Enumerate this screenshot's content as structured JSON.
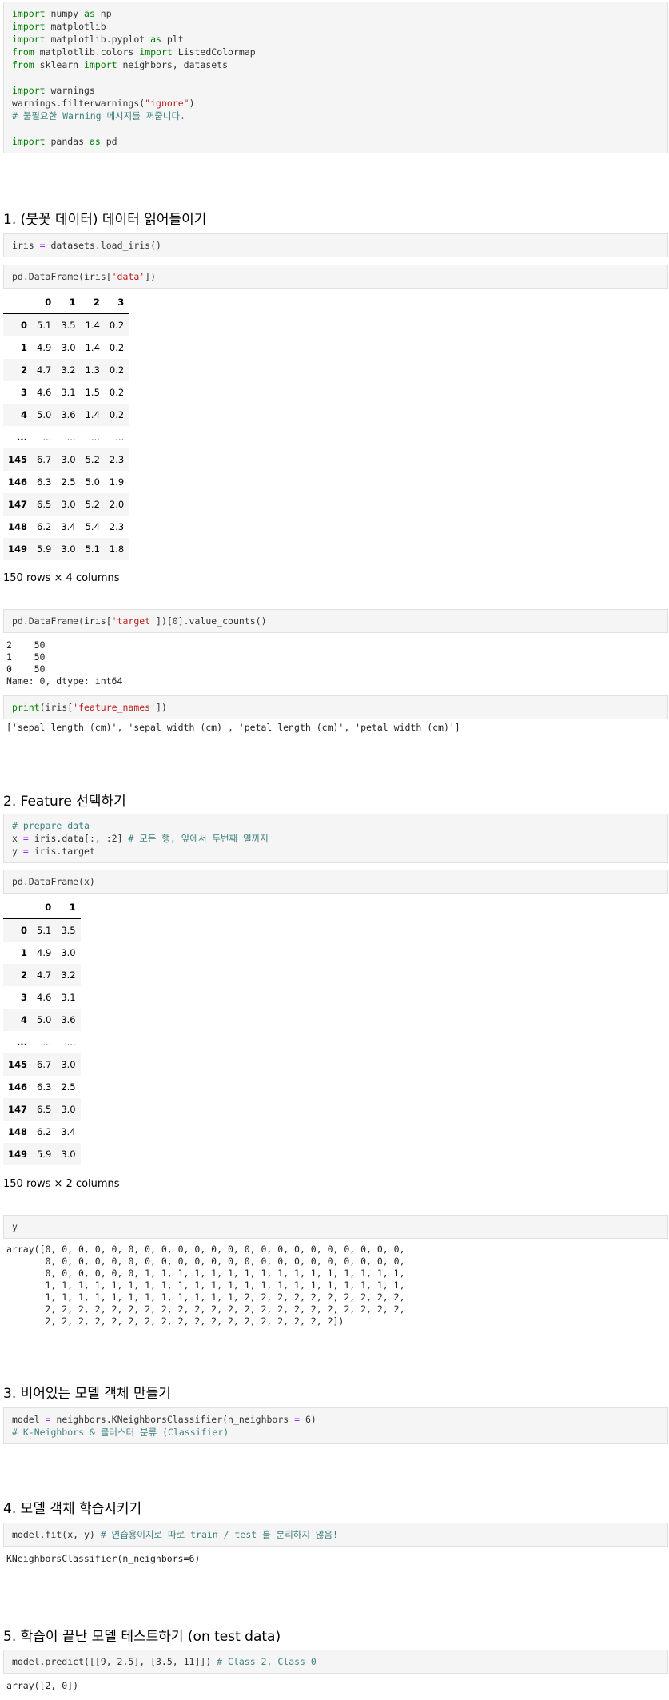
{
  "cells": {
    "imports": [
      {
        "parts": [
          {
            "t": "import",
            "c": "kw"
          },
          {
            "t": " numpy "
          },
          {
            "t": "as",
            "c": "kw"
          },
          {
            "t": " np"
          }
        ]
      },
      {
        "parts": [
          {
            "t": "import",
            "c": "kw"
          },
          {
            "t": " matplotlib"
          }
        ]
      },
      {
        "parts": [
          {
            "t": "import",
            "c": "kw"
          },
          {
            "t": " matplotlib.pyplot "
          },
          {
            "t": "as",
            "c": "kw"
          },
          {
            "t": " plt"
          }
        ]
      },
      {
        "parts": [
          {
            "t": "from",
            "c": "kw"
          },
          {
            "t": " matplotlib.colors "
          },
          {
            "t": "import",
            "c": "kw"
          },
          {
            "t": " ListedColormap"
          }
        ]
      },
      {
        "parts": [
          {
            "t": "from",
            "c": "kw"
          },
          {
            "t": " sklearn "
          },
          {
            "t": "import",
            "c": "kw"
          },
          {
            "t": " neighbors, datasets"
          }
        ]
      },
      {
        "parts": [
          {
            "t": ""
          }
        ]
      },
      {
        "parts": [
          {
            "t": "import",
            "c": "kw"
          },
          {
            "t": " warnings"
          }
        ]
      },
      {
        "parts": [
          {
            "t": "warnings.filterwarnings("
          },
          {
            "t": "\"ignore\"",
            "c": "str"
          },
          {
            "t": ")"
          }
        ]
      },
      {
        "parts": [
          {
            "t": "# 불필요한 Warning 메시지를 꺼줍니다.",
            "c": "cm"
          }
        ]
      },
      {
        "parts": [
          {
            "t": ""
          }
        ]
      },
      {
        "parts": [
          {
            "t": "import",
            "c": "kw"
          },
          {
            "t": " pandas "
          },
          {
            "t": "as",
            "c": "kw"
          },
          {
            "t": " pd"
          }
        ]
      }
    ],
    "load_iris": [
      {
        "parts": [
          {
            "t": "iris "
          },
          {
            "t": "=",
            "c": "op"
          },
          {
            "t": " datasets.load_iris()"
          }
        ]
      }
    ],
    "df_data": [
      {
        "parts": [
          {
            "t": "pd.DataFrame(iris["
          },
          {
            "t": "'data'",
            "c": "str"
          },
          {
            "t": "])"
          }
        ]
      }
    ],
    "value_counts": [
      {
        "parts": [
          {
            "t": "pd.DataFrame(iris["
          },
          {
            "t": "'target'",
            "c": "str"
          },
          {
            "t": "])[0].value_counts()"
          }
        ]
      }
    ],
    "print_features": [
      {
        "parts": [
          {
            "t": "print",
            "c": "kw"
          },
          {
            "t": "(iris["
          },
          {
            "t": "'feature_names'",
            "c": "str"
          },
          {
            "t": "])"
          }
        ]
      }
    ],
    "prepare": [
      {
        "parts": [
          {
            "t": "# prepare data",
            "c": "cm"
          }
        ]
      },
      {
        "parts": [
          {
            "t": "x "
          },
          {
            "t": "=",
            "c": "op"
          },
          {
            "t": " iris.data[:, :2] "
          },
          {
            "t": "# 모든 행, 앞에서 두번째 열까지",
            "c": "cm"
          }
        ]
      },
      {
        "parts": [
          {
            "t": "y "
          },
          {
            "t": "=",
            "c": "op"
          },
          {
            "t": " iris.target"
          }
        ]
      }
    ],
    "df_x": [
      {
        "parts": [
          {
            "t": "pd.DataFrame(x)"
          }
        ]
      }
    ],
    "y": [
      {
        "parts": [
          {
            "t": "y"
          }
        ]
      }
    ],
    "model_create": [
      {
        "parts": [
          {
            "t": "model "
          },
          {
            "t": "=",
            "c": "op"
          },
          {
            "t": " neighbors.KNeighborsClassifier(n_neighbors "
          },
          {
            "t": "=",
            "c": "op"
          },
          {
            "t": " 6)"
          }
        ]
      },
      {
        "parts": [
          {
            "t": "# K-Neighbors & 클러스터 분류 (Classifier)",
            "c": "cm"
          }
        ]
      }
    ],
    "model_fit": [
      {
        "parts": [
          {
            "t": "model.fit(x, y) "
          },
          {
            "t": "# 연습용이지로 따로 train / test 를 분리하지 않음!",
            "c": "cm"
          }
        ]
      }
    ],
    "model_predict": [
      {
        "parts": [
          {
            "t": "model.predict([[9, 2.5], [3.5, 11]]) "
          },
          {
            "t": "# Class 2, Class 0",
            "c": "cm"
          }
        ]
      }
    ]
  },
  "headings": {
    "h1": "1. (붓꽃 데이터) 데이터 읽어들이기",
    "h2": "2. Feature 선택하기",
    "h3": "3. 비어있는 모델 객체 만들기",
    "h4": "4. 모델 객체 학습시키기",
    "h5": "5. 학습이 끝난 모델 테스트하기 (on test data)"
  },
  "df1": {
    "columns": [
      "",
      "0",
      "1",
      "2",
      "3"
    ],
    "rows": [
      [
        "0",
        "5.1",
        "3.5",
        "1.4",
        "0.2"
      ],
      [
        "1",
        "4.9",
        "3.0",
        "1.4",
        "0.2"
      ],
      [
        "2",
        "4.7",
        "3.2",
        "1.3",
        "0.2"
      ],
      [
        "3",
        "4.6",
        "3.1",
        "1.5",
        "0.2"
      ],
      [
        "4",
        "5.0",
        "3.6",
        "1.4",
        "0.2"
      ],
      [
        "...",
        "...",
        "...",
        "...",
        "..."
      ],
      [
        "145",
        "6.7",
        "3.0",
        "5.2",
        "2.3"
      ],
      [
        "146",
        "6.3",
        "2.5",
        "5.0",
        "1.9"
      ],
      [
        "147",
        "6.5",
        "3.0",
        "5.2",
        "2.0"
      ],
      [
        "148",
        "6.2",
        "3.4",
        "5.4",
        "2.3"
      ],
      [
        "149",
        "5.9",
        "3.0",
        "5.1",
        "1.8"
      ]
    ],
    "dims": "150 rows × 4 columns"
  },
  "df2": {
    "columns": [
      "",
      "0",
      "1"
    ],
    "rows": [
      [
        "0",
        "5.1",
        "3.5"
      ],
      [
        "1",
        "4.9",
        "3.0"
      ],
      [
        "2",
        "4.7",
        "3.2"
      ],
      [
        "3",
        "4.6",
        "3.1"
      ],
      [
        "4",
        "5.0",
        "3.6"
      ],
      [
        "...",
        "...",
        "..."
      ],
      [
        "145",
        "6.7",
        "3.0"
      ],
      [
        "146",
        "6.3",
        "2.5"
      ],
      [
        "147",
        "6.5",
        "3.0"
      ],
      [
        "148",
        "6.2",
        "3.4"
      ],
      [
        "149",
        "5.9",
        "3.0"
      ]
    ],
    "dims": "150 rows × 2 columns"
  },
  "outputs": {
    "value_counts": "2    50\n1    50\n0    50\nName: 0, dtype: int64",
    "feature_names": "['sepal length (cm)', 'sepal width (cm)', 'petal length (cm)', 'petal width (cm)']",
    "y_array": "array([0, 0, 0, 0, 0, 0, 0, 0, 0, 0, 0, 0, 0, 0, 0, 0, 0, 0, 0, 0, 0, 0,\n       0, 0, 0, 0, 0, 0, 0, 0, 0, 0, 0, 0, 0, 0, 0, 0, 0, 0, 0, 0, 0, 0,\n       0, 0, 0, 0, 0, 0, 1, 1, 1, 1, 1, 1, 1, 1, 1, 1, 1, 1, 1, 1, 1, 1,\n       1, 1, 1, 1, 1, 1, 1, 1, 1, 1, 1, 1, 1, 1, 1, 1, 1, 1, 1, 1, 1, 1,\n       1, 1, 1, 1, 1, 1, 1, 1, 1, 1, 1, 1, 2, 2, 2, 2, 2, 2, 2, 2, 2, 2,\n       2, 2, 2, 2, 2, 2, 2, 2, 2, 2, 2, 2, 2, 2, 2, 2, 2, 2, 2, 2, 2, 2,\n       2, 2, 2, 2, 2, 2, 2, 2, 2, 2, 2, 2, 2, 2, 2, 2, 2, 2])",
    "fit": "KNeighborsClassifier(n_neighbors=6)",
    "predict": "array([2, 0])"
  }
}
